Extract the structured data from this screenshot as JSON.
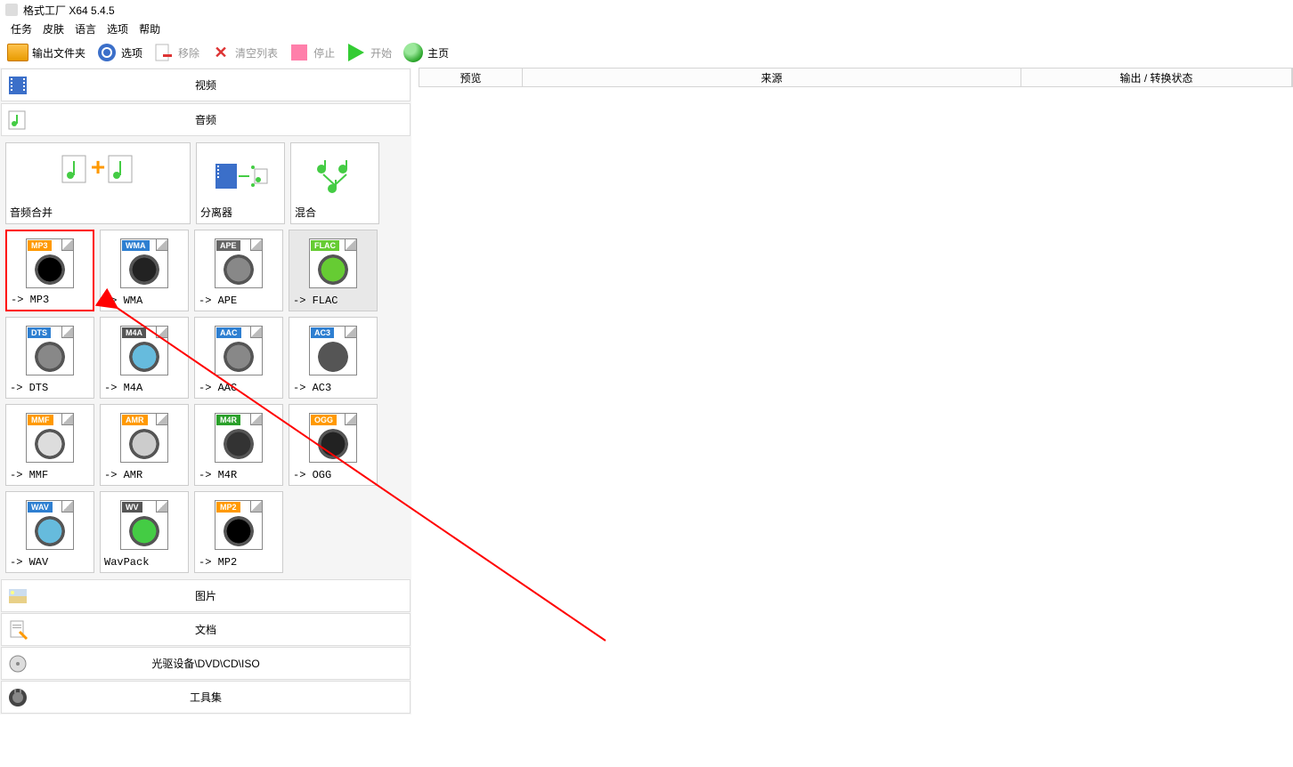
{
  "window": {
    "title": "格式工厂 X64 5.4.5"
  },
  "menu": {
    "items": [
      "任务",
      "皮肤",
      "语言",
      "选项",
      "帮助"
    ]
  },
  "toolbar": {
    "output_folder": "输出文件夹",
    "options": "选项",
    "remove": "移除",
    "clear_list": "清空列表",
    "stop": "停止",
    "start": "开始",
    "home": "主页"
  },
  "categories": {
    "video": "视频",
    "audio": "音频",
    "picture": "图片",
    "document": "文档",
    "drive": "光驱设备\\DVD\\CD\\ISO",
    "tools": "工具集"
  },
  "audio_tools": {
    "merge": "音频合并",
    "splitter": "分离器",
    "mix": "混合"
  },
  "formats": [
    {
      "name": "MP3",
      "label": "-> MP3",
      "badge_color": "#ff9900",
      "highlight": true
    },
    {
      "name": "WMA",
      "label": "-> WMA",
      "badge_color": "#2e7fd1"
    },
    {
      "name": "APE",
      "label": "-> APE",
      "badge_color": "#666666"
    },
    {
      "name": "FLAC",
      "label": "-> FLAC",
      "badge_color": "#66cc33",
      "selected": true
    },
    {
      "name": "DTS",
      "label": "-> DTS",
      "badge_color": "#2e7fd1"
    },
    {
      "name": "M4A",
      "label": "-> M4A",
      "badge_color": "#555555"
    },
    {
      "name": "AAC",
      "label": "-> AAC",
      "badge_color": "#2e7fd1"
    },
    {
      "name": "AC3",
      "label": "-> AC3",
      "badge_color": "#2e7fd1"
    },
    {
      "name": "MMF",
      "label": "-> MMF",
      "badge_color": "#ff9900"
    },
    {
      "name": "AMR",
      "label": "-> AMR",
      "badge_color": "#ff9900"
    },
    {
      "name": "M4R",
      "label": "-> M4R",
      "badge_color": "#2aa02a"
    },
    {
      "name": "OGG",
      "label": "-> OGG",
      "badge_color": "#ff9900"
    },
    {
      "name": "WAV",
      "label": "-> WAV",
      "badge_color": "#2e7fd1"
    },
    {
      "name": "WV",
      "label": "WavPack",
      "badge_color": "#555555"
    },
    {
      "name": "MP2",
      "label": "-> MP2",
      "badge_color": "#ff9900"
    }
  ],
  "table": {
    "preview": "预览",
    "source": "来源",
    "output_state": "输出 / 转换状态"
  }
}
